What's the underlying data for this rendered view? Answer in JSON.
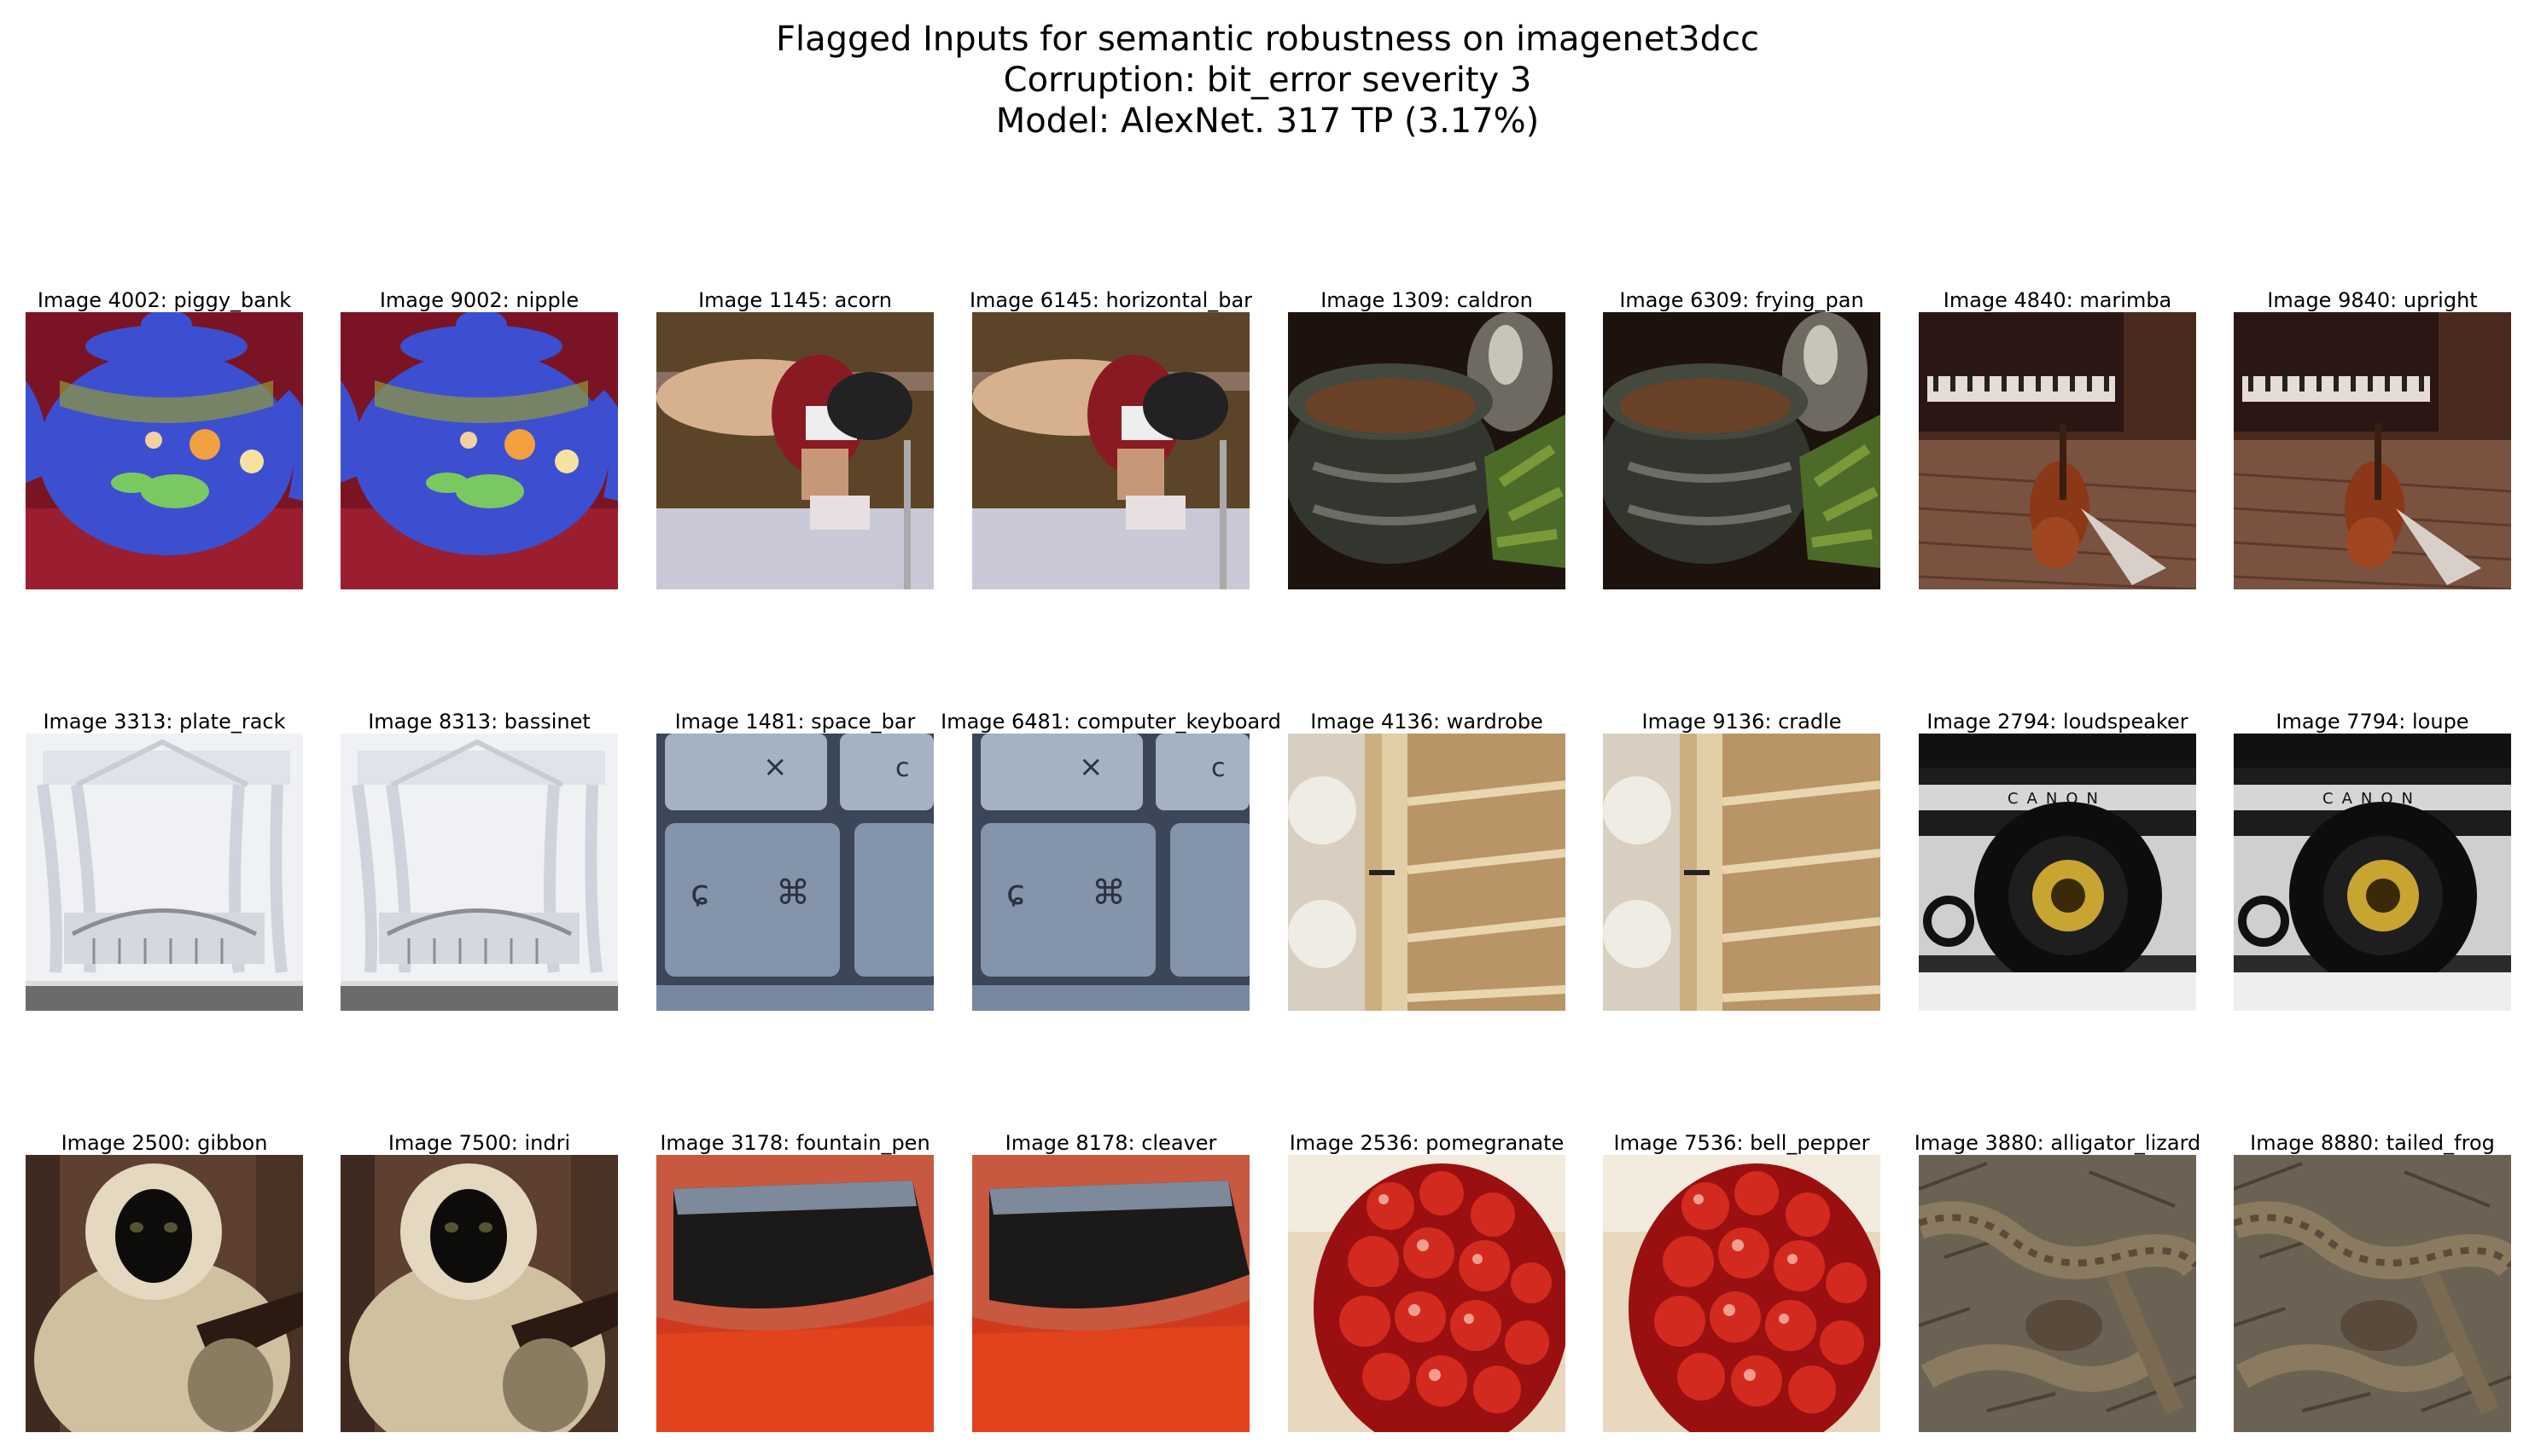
{
  "title": {
    "line1": "Flagged Inputs for semantic robustness on imagenet3dcc",
    "line2": "Corruption: bit_error severity 3",
    "line3": "Model: AlexNet. 317 TP (3.17%)"
  },
  "rows": [
    [
      {
        "caption": "Image 4002: piggy_bank",
        "scene": "teapot"
      },
      {
        "caption": "Image 9002: nipple",
        "scene": "teapot"
      },
      {
        "caption": "Image 1145: acorn",
        "scene": "gymnast"
      },
      {
        "caption": "Image 6145: horizontal_bar",
        "scene": "gymnast"
      },
      {
        "caption": "Image 1309: caldron",
        "scene": "pot"
      },
      {
        "caption": "Image 6309: frying_pan",
        "scene": "pot"
      },
      {
        "caption": "Image 4840: marimba",
        "scene": "violin"
      },
      {
        "caption": "Image 9840: upright",
        "scene": "violin"
      }
    ],
    [
      {
        "caption": "Image 3313: plate_rack",
        "scene": "canopy-bed"
      },
      {
        "caption": "Image 8313: bassinet",
        "scene": "canopy-bed"
      },
      {
        "caption": "Image 1481: space_bar",
        "scene": "keyboard"
      },
      {
        "caption": "Image 6481: computer_keyboard",
        "scene": "keyboard"
      },
      {
        "caption": "Image 4136: wardrobe",
        "scene": "shelves"
      },
      {
        "caption": "Image 9136: cradle",
        "scene": "shelves"
      },
      {
        "caption": "Image 2794: loudspeaker",
        "scene": "camera",
        "logo_text": "CANON"
      },
      {
        "caption": "Image 7794: loupe",
        "scene": "camera",
        "logo_text": "CANON"
      }
    ],
    [
      {
        "caption": "Image 2500: gibbon",
        "scene": "monkey"
      },
      {
        "caption": "Image 7500: indri",
        "scene": "monkey"
      },
      {
        "caption": "Image 3178: fountain_pen",
        "scene": "pen"
      },
      {
        "caption": "Image 8178: cleaver",
        "scene": "pen"
      },
      {
        "caption": "Image 2536: pomegranate",
        "scene": "pomegranate"
      },
      {
        "caption": "Image 7536: bell_pepper",
        "scene": "pomegranate"
      },
      {
        "caption": "Image 3880: alligator_lizard",
        "scene": "lizard"
      },
      {
        "caption": "Image 8880: tailed_frog",
        "scene": "lizard"
      }
    ]
  ]
}
